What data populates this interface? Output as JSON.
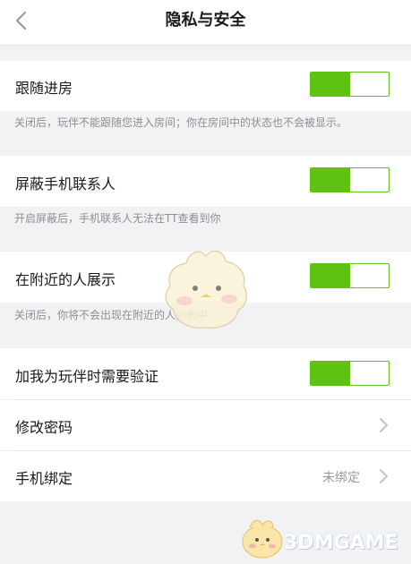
{
  "header": {
    "title": "隐私与安全",
    "back_icon": "chevron-left-icon"
  },
  "settings": {
    "follow_room": {
      "label": "跟随进房",
      "enabled": true,
      "description": "关闭后，玩伴不能跟随您进入房间；你在房间中的状态也不会被显示。"
    },
    "block_contacts": {
      "label": "屏蔽手机联系人",
      "enabled": true,
      "description": "开启屏蔽后，手机联系人无法在TT查看到你"
    },
    "show_nearby": {
      "label": "在附近的人展示",
      "enabled": true,
      "description": "关闭后，你将不会出现在附近的人列表中"
    },
    "verify_friend": {
      "label": "加我为玩伴时需要验证",
      "enabled": true
    },
    "change_password": {
      "label": "修改密码"
    },
    "bind_phone": {
      "label": "手机绑定",
      "value": "未绑定"
    }
  },
  "watermark": {
    "text": "3DMGAME"
  },
  "colors": {
    "toggle_on": "#5fc112",
    "background": "#f2f2f4",
    "secondary_text": "#8e8e93"
  }
}
